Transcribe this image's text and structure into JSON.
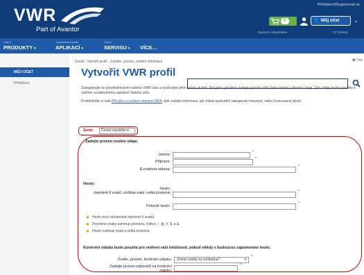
{
  "header": {
    "brand": "VWR",
    "sub": "Part of Avantor",
    "top_link": "Přihlášení/Registrovat se",
    "cart_count": "0",
    "account_label": "Můj účet",
    "links": [
      "Expresní objednávka",
      "CF [Dotkn]"
    ]
  },
  "nav": {
    "items": [
      {
        "small": "A až Z",
        "big": "PRODUKTY"
      },
      {
        "small": "Vyhledávání podle",
        "big": "APLIKACÍ"
      },
      {
        "small": "Více o",
        "big": "SERVISU"
      },
      {
        "small": "",
        "big": "VÍCE…"
      }
    ]
  },
  "sidebar": {
    "heading": "MŮJ ÚČET",
    "item": "Přihlášení"
  },
  "main": {
    "breadcrumb": "Domů › Vytvořit profil › Založte, prosím, osobní informace",
    "print": "Tisk",
    "title": "Vytvořit VWR profil",
    "intro1": "Zaregistrujte se prostřednictvím našeho VWR účtu a využívejte plné našich služeb. Pro jeho vytvoření zadejte prosím níže Vaše osobní a firemní údaje. Tyto údaje budou použity k ověření a následnému založení Vašeho účtu.",
    "intro2_a": "Prohlédněte si naši ",
    "intro2_link": "Příručku o zrušení omezení DEA",
    "intro2_b": ", kde získáte informace, jak získat oprávnění nakupovat omezené, nebo licencované zboží."
  },
  "form": {
    "country_label": "Země:",
    "country_value": "Česká republika ▾",
    "personal_heading": "Zadejte prosím osobní údaje:",
    "first_name": "Jméno:",
    "last_name": "Příjmení:",
    "email": "E-mailová adresa:",
    "password_heading": "Heslo:",
    "password_label": "Heslo:",
    "password_hint": "(nejméně 8 znaků, rozlišuje malá i velká písmena)",
    "confirm_password": "Potvrdit heslo:",
    "rules": [
      "Heslo musí obsahovat nejméně 8 znaků.",
      "Povolené znaky zahrnují písmena, číslice, !, @, #, $, a &.",
      "Heslo rozlišuje malá a velká písmena"
    ],
    "question_heading": "Kontrolní otázka bude použita pro ověření vaší totožnosti, pokud někdy v budoucnu zapomenete heslo.",
    "question_label": "Zvolte, prosím, kontrolní otázku:",
    "question_value": "Jméno matky za svobodna?",
    "answer_label": "Zadejte prosím odpověď na kontrolní otázku:",
    "required_mark": "*"
  },
  "colors": {
    "header_bg": "#0f3d7a",
    "nav_bg": "#1e5aa8",
    "highlight": "#cc0000",
    "bullet": "#f39c12"
  }
}
